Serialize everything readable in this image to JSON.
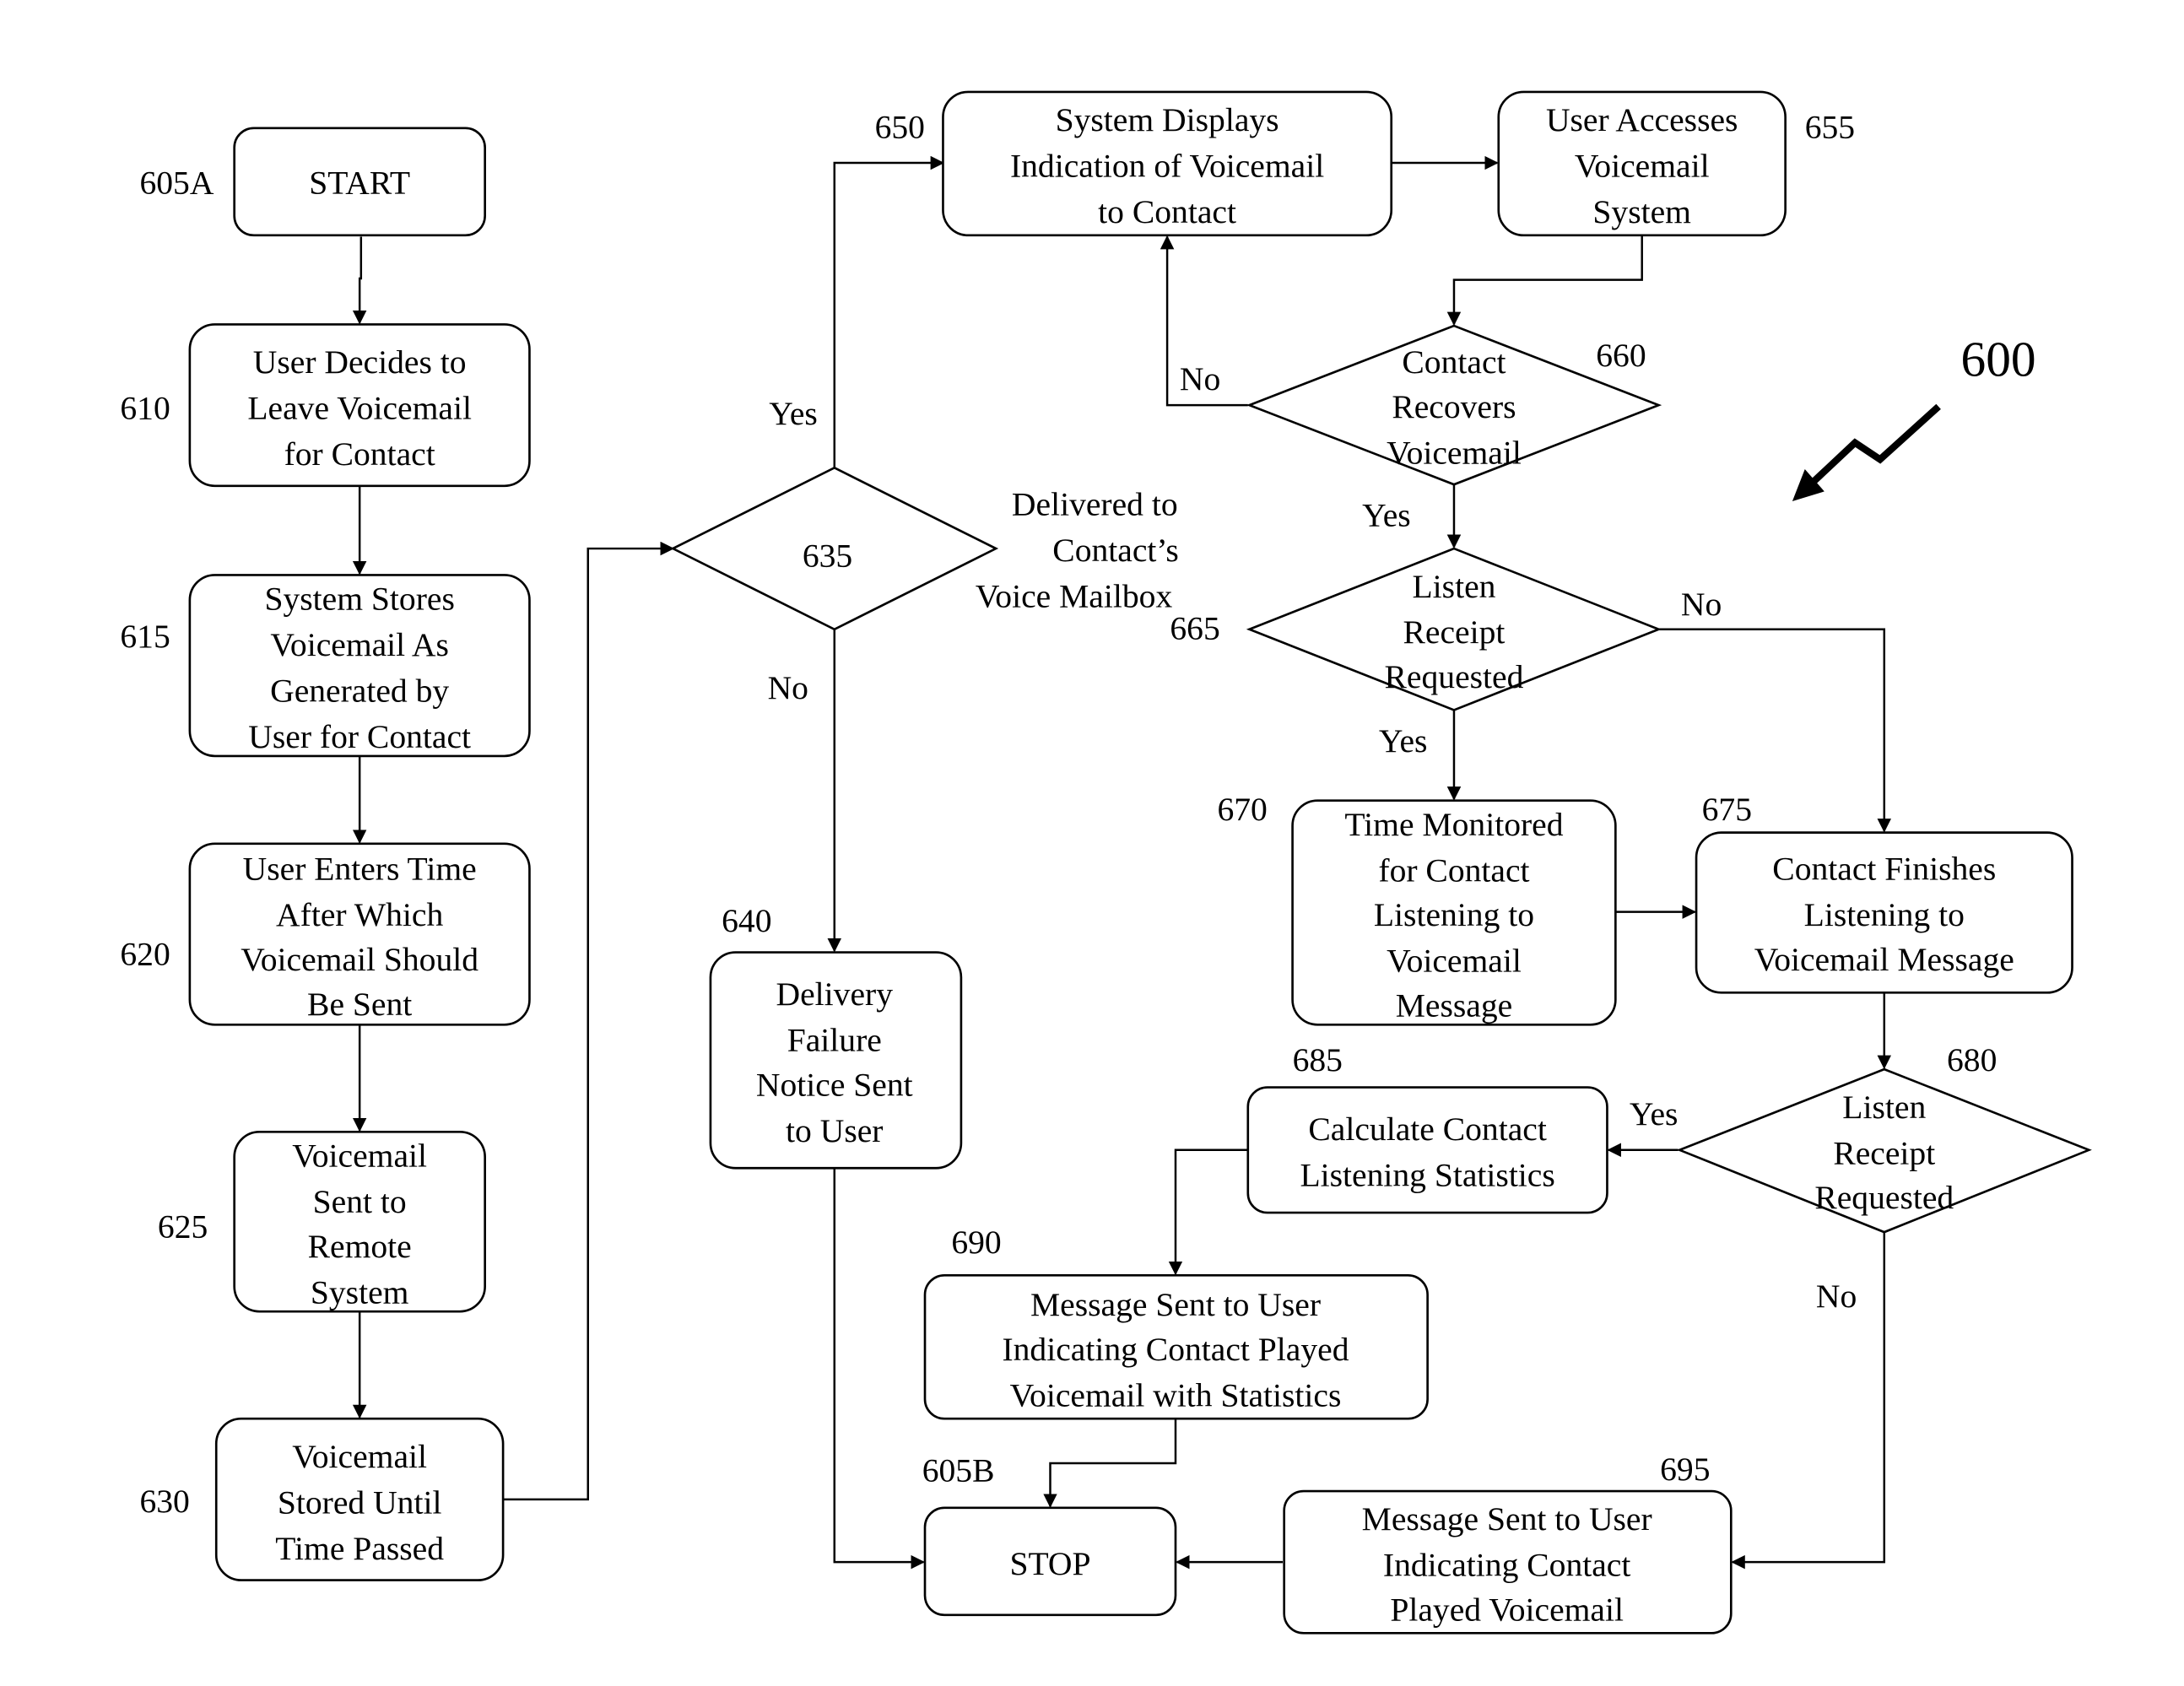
{
  "figure_ref": "600",
  "nodes": {
    "n605a": {
      "ref": "605A",
      "lines": [
        "START"
      ]
    },
    "n610": {
      "ref": "610",
      "lines": [
        "User Decides to",
        "Leave Voicemail",
        "for Contact"
      ]
    },
    "n615": {
      "ref": "615",
      "lines": [
        "System Stores",
        "Voicemail As",
        "Generated by",
        "User for Contact"
      ]
    },
    "n620": {
      "ref": "620",
      "lines": [
        "User Enters Time",
        "After Which",
        "Voicemail Should",
        "Be Sent"
      ]
    },
    "n625": {
      "ref": "625",
      "lines": [
        "Voicemail",
        "Sent to",
        "Remote",
        "System"
      ]
    },
    "n630": {
      "ref": "630",
      "lines": [
        "Voicemail",
        "Stored Until",
        "Time Passed"
      ]
    },
    "n635": {
      "ref": "635",
      "lines": [
        "Delivered to",
        "Contact’s",
        "Voice Mailbox"
      ]
    },
    "n640": {
      "ref": "640",
      "lines": [
        "Delivery",
        "Failure",
        "Notice Sent",
        "to User"
      ]
    },
    "n650": {
      "ref": "650",
      "lines": [
        "System Displays",
        "Indication of Voicemail",
        "to Contact"
      ]
    },
    "n655": {
      "ref": "655",
      "lines": [
        "User Accesses",
        "Voicemail",
        "System"
      ]
    },
    "n660": {
      "ref": "660",
      "lines": [
        "Contact",
        "Recovers",
        "Voicemail"
      ]
    },
    "n665": {
      "ref": "665",
      "lines": [
        "Listen",
        "Receipt",
        "Requested"
      ]
    },
    "n670": {
      "ref": "670",
      "lines": [
        "Time Monitored",
        "for Contact",
        "Listening to",
        "Voicemail",
        "Message"
      ]
    },
    "n675": {
      "ref": "675",
      "lines": [
        "Contact Finishes",
        "Listening to",
        "Voicemail Message"
      ]
    },
    "n680": {
      "ref": "680",
      "lines": [
        "Listen",
        "Receipt",
        "Requested"
      ]
    },
    "n685": {
      "ref": "685",
      "lines": [
        "Calculate Contact",
        "Listening Statistics"
      ]
    },
    "n690": {
      "ref": "690",
      "lines": [
        "Message Sent to User",
        "Indicating Contact Played",
        "Voicemail with Statistics"
      ]
    },
    "n695": {
      "ref": "695",
      "lines": [
        "Message Sent to User",
        "Indicating Contact",
        "Played Voicemail"
      ]
    },
    "n605b": {
      "ref": "605B",
      "lines": [
        "STOP"
      ]
    }
  },
  "edge_labels": {
    "yes_635": "Yes",
    "no_635": "No",
    "no_660": "No",
    "yes_660": "Yes",
    "no_665": "No",
    "yes_665": "Yes",
    "yes_680": "Yes",
    "no_680": "No"
  }
}
